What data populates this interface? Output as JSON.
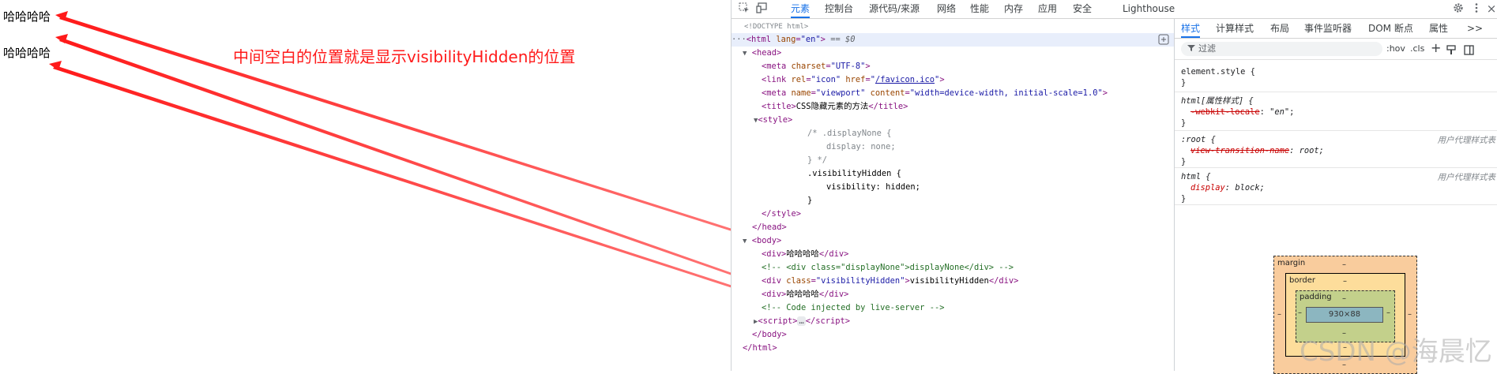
{
  "page": {
    "lines": [
      "哈哈哈哈",
      "哈哈哈哈"
    ],
    "annotation": "中间空白的位置就是显示visibilityHidden的位置",
    "annotation_color": "#ff1a1a"
  },
  "devtools": {
    "tabs": [
      "元素",
      "控制台",
      "源代码/来源",
      "网络",
      "性能",
      "内存",
      "应用",
      "安全",
      "Lighthouse"
    ],
    "active_tab": "元素",
    "icons": [
      "inspect-icon",
      "device-toggle-icon",
      "settings-gear-icon",
      "kebab-menu-icon",
      "close-icon"
    ],
    "close_glyph": "×",
    "elements": {
      "selected_suffix": "== $0",
      "ellipsis": "…"
    },
    "styles_tabs": [
      "样式",
      "计算样式",
      "布局",
      "事件监听器",
      "DOM 断点",
      "属性"
    ],
    "styles_more": ">>",
    "filter_placeholder": "过滤",
    "hov": ":hov",
    "cls": ".cls",
    "plus": "+",
    "rules": {
      "element_style": "element.style {",
      "close_brace": "}",
      "html_attr_selector": "html[属性样式] {",
      "locale_prop": "-webkit-locale",
      "locale_val": "\"en\"",
      "root_selector": ":root {",
      "root_origin": "用户代理样式表",
      "vt_prop": "view-transition-name",
      "vt_val": "root",
      "html_selector": "html {",
      "html_origin": "用户代理样式表",
      "display_prop": "display",
      "display_val": "block"
    },
    "box_model": {
      "margin": "margin",
      "border": "border",
      "padding": "padding",
      "content": "930×88",
      "dash": "–"
    }
  },
  "watermark": "CSDN @海晨忆"
}
